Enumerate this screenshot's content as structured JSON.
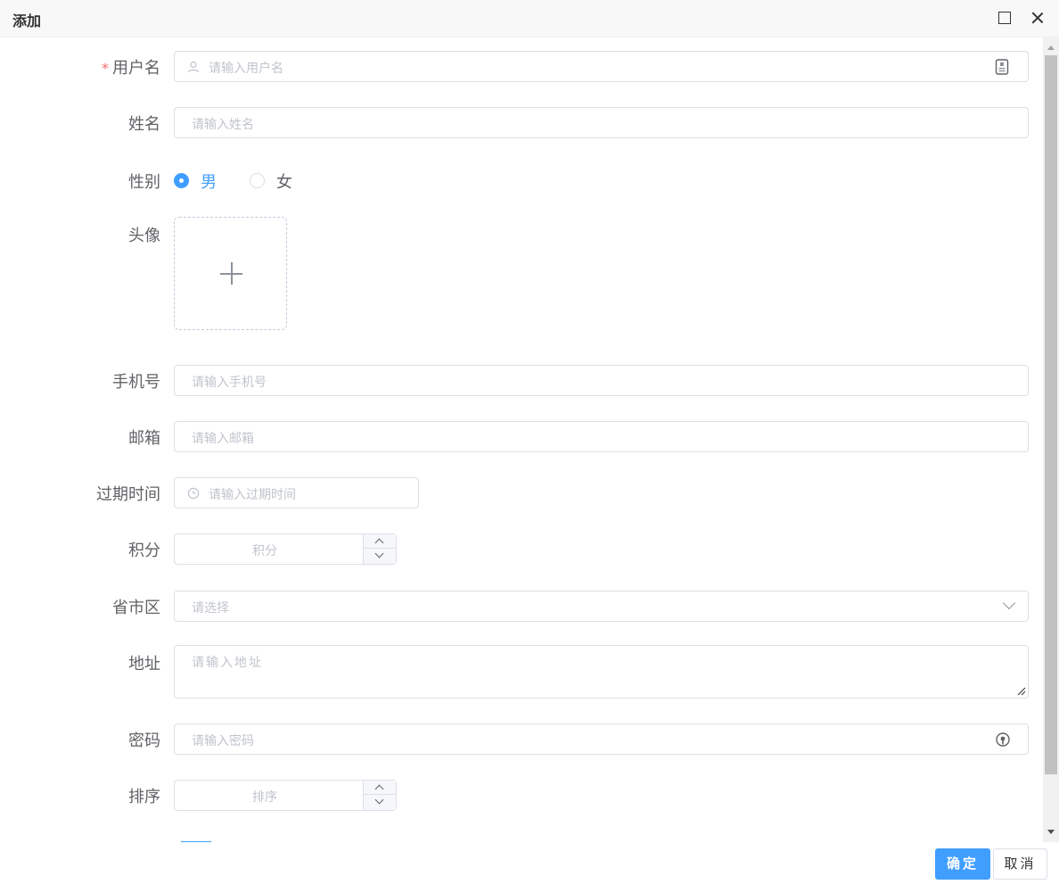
{
  "dialog": {
    "title": "添加"
  },
  "form": {
    "username": {
      "label": "用户名",
      "required_mark": "*",
      "placeholder": "请输入用户名"
    },
    "name": {
      "label": "姓名",
      "placeholder": "请输入姓名"
    },
    "gender": {
      "label": "性别",
      "options": [
        "男",
        "女"
      ],
      "selected": "男"
    },
    "avatar": {
      "label": "头像"
    },
    "phone": {
      "label": "手机号",
      "placeholder": "请输入手机号"
    },
    "email": {
      "label": "邮箱",
      "placeholder": "请输入邮箱"
    },
    "expire": {
      "label": "过期时间",
      "placeholder": "请输入过期时间"
    },
    "points": {
      "label": "积分",
      "placeholder": "积分"
    },
    "region": {
      "label": "省市区",
      "placeholder": "请选择"
    },
    "address": {
      "label": "地址",
      "placeholder": "请输入地址"
    },
    "password": {
      "label": "密码",
      "placeholder": "请输入密码"
    },
    "sort": {
      "label": "排序",
      "placeholder": "排序"
    }
  },
  "footer": {
    "ok_label": "确定",
    "cancel_label": "取消"
  },
  "colors": {
    "primary": "#409eff",
    "required": "#f56c6c",
    "border": "#dcdfe6",
    "placeholder": "#c0c4cc"
  }
}
